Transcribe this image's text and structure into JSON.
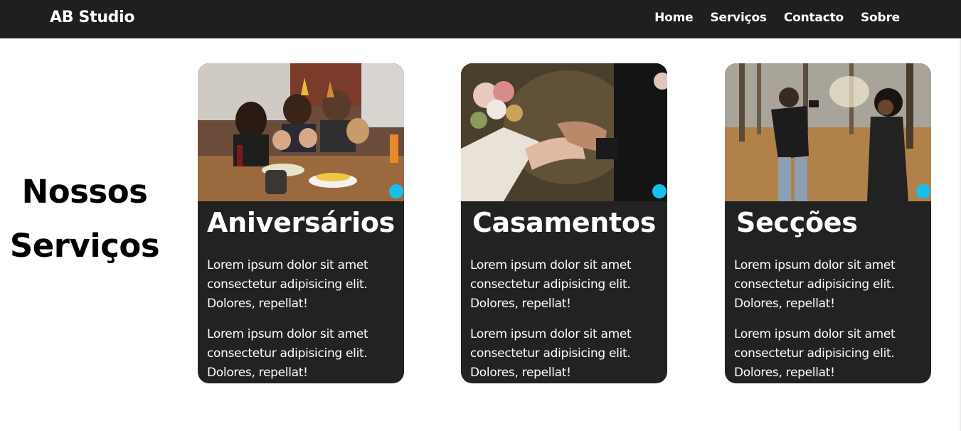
{
  "nav": {
    "brand": "AB Studio",
    "links": [
      "Home",
      "Serviços",
      "Contacto",
      "Sobre"
    ]
  },
  "section": {
    "title_line1": "Nossos",
    "title_line2": "Serviços"
  },
  "cards": [
    {
      "title": "Aniversários",
      "image": "birthday-party-photo",
      "paragraphs": [
        "Lorem ipsum dolor sit amet consectetur adipisicing elit. Dolores, repellat!",
        "Lorem ipsum dolor sit amet consectetur adipisicing elit. Dolores, repellat!"
      ]
    },
    {
      "title": "Casamentos",
      "image": "wedding-hands-photo",
      "paragraphs": [
        "Lorem ipsum dolor sit amet consectetur adipisicing elit. Dolores, repellat!",
        "Lorem ipsum dolor sit amet consectetur adipisicing elit. Dolores, repellat!"
      ]
    },
    {
      "title": "Secções",
      "image": "photoshoot-forest-photo",
      "paragraphs": [
        "Lorem ipsum dolor sit amet consectetur adipisicing elit. Dolores, repellat!",
        "Lorem ipsum dolor sit amet consectetur adipisicing elit. Dolores, repellat!"
      ]
    }
  ],
  "colors": {
    "navbar_bg": "#1f1f1f",
    "card_bg": "#222222",
    "accent_dot": "#17c0ec",
    "text_light": "#ffffff",
    "text_dark": "#000000"
  }
}
